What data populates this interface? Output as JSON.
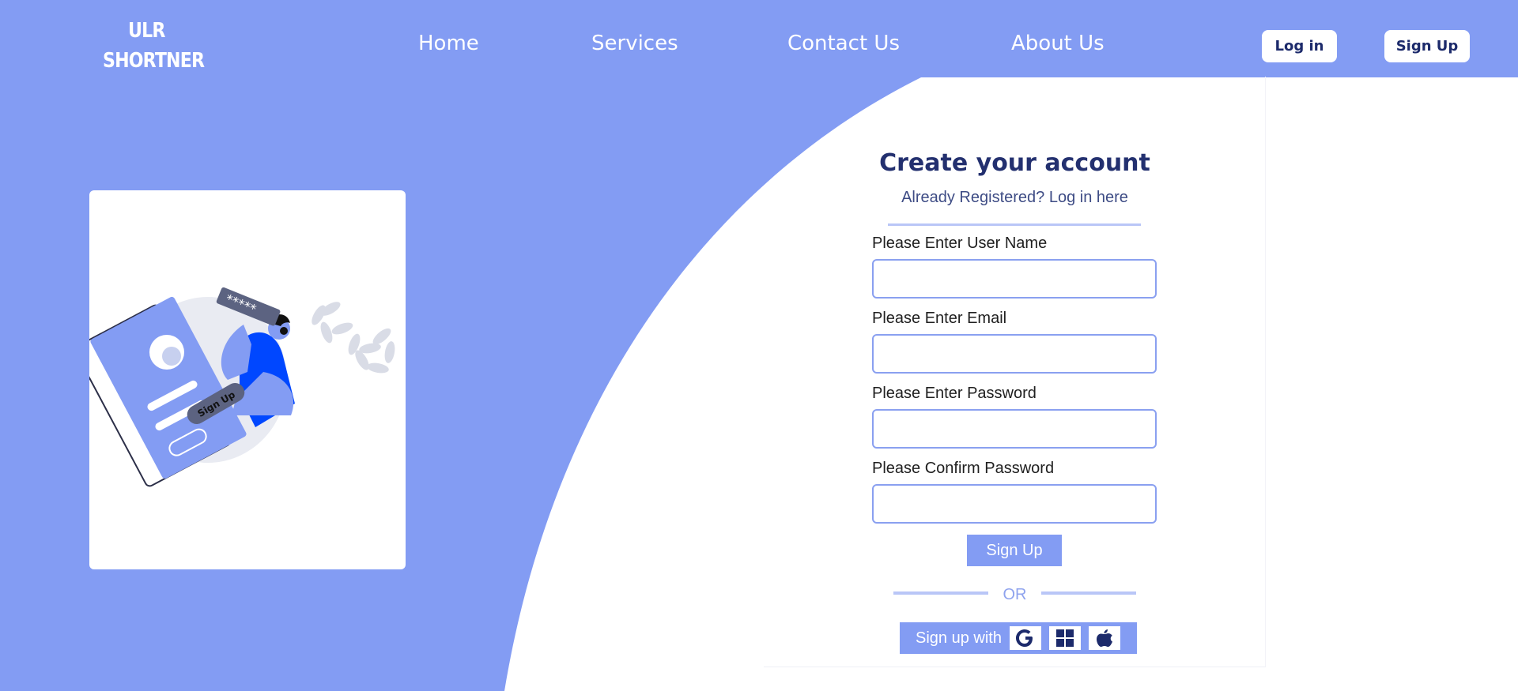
{
  "logo": {
    "line1": "ULR",
    "line2": "SHORTNER"
  },
  "nav": {
    "items": [
      "Home",
      "Services",
      "Contact Us",
      "About Us"
    ]
  },
  "auth": {
    "login_label": "Log in",
    "signup_label": "Sign Up"
  },
  "illustration": {
    "badge_text": "Sign Up",
    "password_mask": "*****"
  },
  "form": {
    "title": "Create your account",
    "subtitle": "Already Registered? Log in here",
    "fields": [
      {
        "label": "Please Enter User Name",
        "value": ""
      },
      {
        "label": "Please Enter Email",
        "value": ""
      },
      {
        "label": "Please Enter Password",
        "value": ""
      },
      {
        "label": "Please Confirm Password",
        "value": ""
      }
    ],
    "submit_label": "Sign Up",
    "or_text": "OR",
    "social_label": "Sign up with",
    "social_icons": [
      "google-icon",
      "windows-icon",
      "apple-icon"
    ]
  },
  "colors": {
    "brand": "#839cf3",
    "text_dark": "#23306f",
    "accent_blue": "#0047ff"
  }
}
